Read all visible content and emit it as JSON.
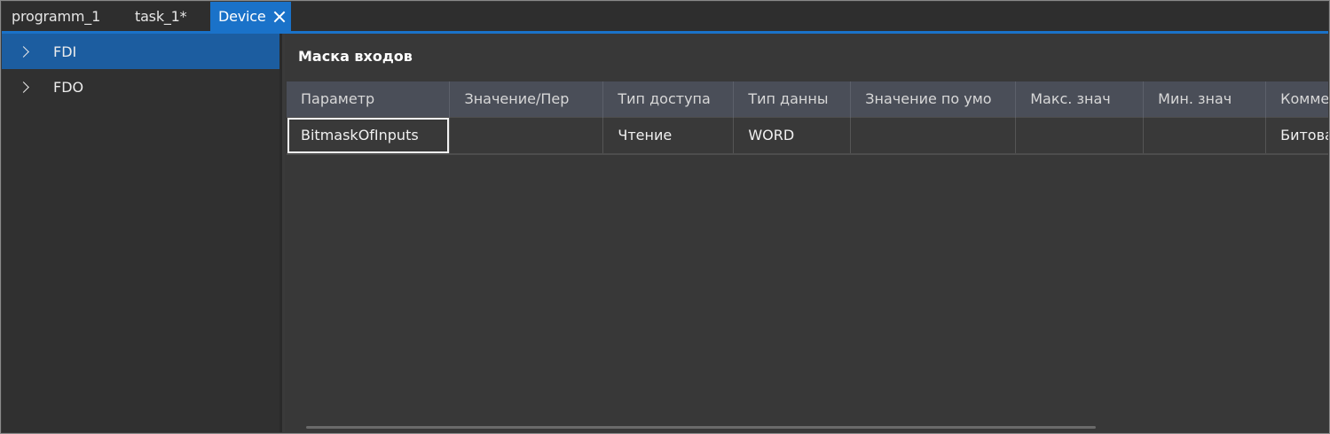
{
  "tabs": [
    {
      "label": "programm_1"
    },
    {
      "label": "task_1*"
    },
    {
      "label": "Device"
    }
  ],
  "sidebar": {
    "items": [
      {
        "label": "FDI"
      },
      {
        "label": "FDO"
      }
    ]
  },
  "main": {
    "title": "Маска входов",
    "columns": [
      "Параметр",
      "Значение/Пер",
      "Тип доступа",
      "Тип данны",
      "Значение по умо",
      "Макс. знач",
      "Мин. знач",
      "Комме"
    ],
    "rows": [
      [
        "BitmaskOfInputs",
        "",
        "Чтение",
        "WORD",
        "",
        "",
        "",
        "Битова"
      ]
    ]
  },
  "colors": {
    "accent": "#1a72c9",
    "selected_tree": "#1c5da0",
    "header_bg": "#4a4e58"
  }
}
